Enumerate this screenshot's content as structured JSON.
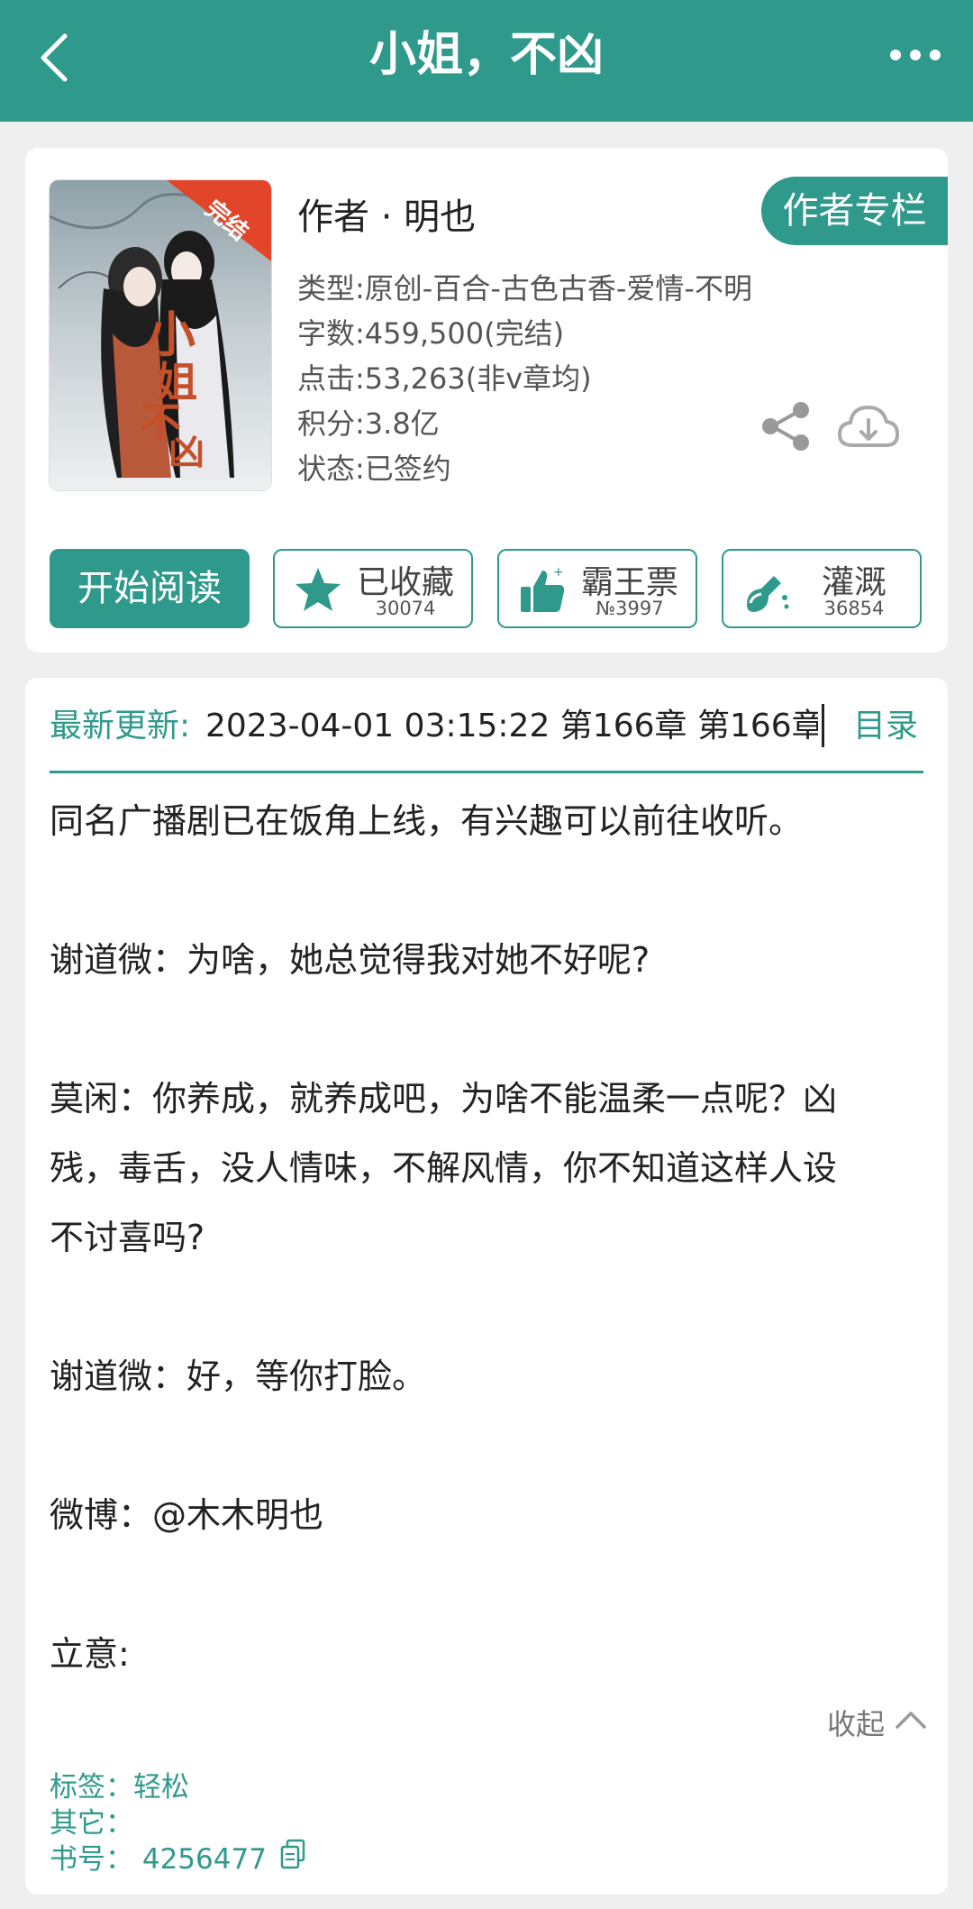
{
  "header": {
    "title": "小姐，不凶"
  },
  "book": {
    "author_line": "作者 · 明也",
    "author_column_label": "作者专栏",
    "cover_badge": "完结",
    "type": "类型:原创-百合-古色古香-爱情-不明",
    "word_count": "字数:459,500(完结)",
    "clicks": "点击:53,263(非v章均)",
    "score": "积分:3.8亿",
    "status": "状态:已签约"
  },
  "actions": {
    "read_label": "开始阅读",
    "favorite_label": "已收藏",
    "favorite_count": "30074",
    "ticket_label": "霸王票",
    "ticket_count": "№3997",
    "water_label": "灌溉",
    "water_count": "36854"
  },
  "update": {
    "label": "最新更新:",
    "text": "2023-04-01 03:15:22   第166章 第166章",
    "toc_label": "目录"
  },
  "description": {
    "lines": [
      "同名广播剧已在饭角上线，有兴趣可以前往收听。",
      "谢道微：为啥，她总觉得我对她不好呢?",
      "莫闲：你养成，就养成吧，为啥不能温柔一点呢？凶",
      "残，毒舌，没人情味，不解风情，你不知道这样人设",
      "不讨喜吗?",
      "谢道微：好，等你打脸。",
      "微博：@木木明也",
      "立意:"
    ],
    "collapse_label": "收起"
  },
  "info": {
    "tags": "标签：轻松",
    "other": "其它：",
    "book_id": "书号： 4256477"
  },
  "colors": {
    "accent": "#2f9a8c",
    "background": "#efefef"
  }
}
